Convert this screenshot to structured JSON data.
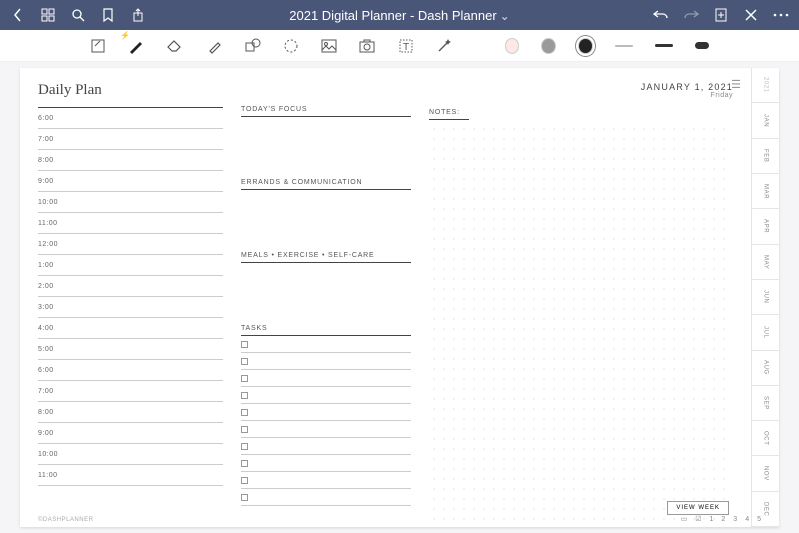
{
  "topbar": {
    "title": "2021 Digital Planner - Dash Planner"
  },
  "planner": {
    "title": "Daily Plan",
    "date": "JANUARY 1, 2021",
    "day": "Friday",
    "hours": [
      "6:00",
      "7:00",
      "8:00",
      "9:00",
      "10:00",
      "11:00",
      "12:00",
      "1:00",
      "2:00",
      "3:00",
      "4:00",
      "5:00",
      "6:00",
      "7:00",
      "8:00",
      "9:00",
      "10:00",
      "11:00"
    ],
    "sections": {
      "focus": "TODAY'S FOCUS",
      "errands": "ERRANDS & COMMUNICATION",
      "meals": "MEALS • EXERCISE • SELF-CARE",
      "tasks": "TASKS",
      "notes": "NOTES:"
    },
    "task_count": 10,
    "view_week": "VIEW WEEK",
    "footer": "©DASHPLANNER",
    "pages": [
      "1",
      "2",
      "3",
      "4",
      "5"
    ]
  },
  "tabs": {
    "year": "2021",
    "months": [
      "JAN",
      "FEB",
      "MAR",
      "APR",
      "MAY",
      "JUN",
      "JUL",
      "AUG",
      "SEP",
      "OCT",
      "NOV",
      "DEC"
    ]
  }
}
